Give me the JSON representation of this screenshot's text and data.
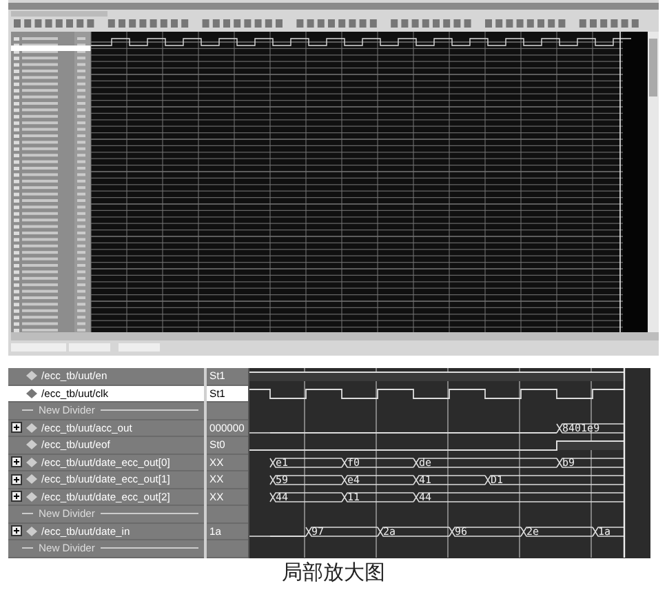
{
  "zoom_panel": {
    "signals": [
      {
        "kind": "bit",
        "name": "/ecc_tb/uut/en",
        "value": "St1",
        "selected": false,
        "expandable": false,
        "high": [
          true,
          true,
          true,
          true,
          true,
          true,
          true,
          true,
          true,
          true
        ]
      },
      {
        "kind": "clock",
        "name": "/ecc_tb/uut/clk",
        "value": "St1",
        "selected": true,
        "expandable": false
      },
      {
        "kind": "divider",
        "name": "New Divider"
      },
      {
        "kind": "bus",
        "name": "/ecc_tb/uut/acc_out",
        "value": "000000",
        "selected": false,
        "expandable": true,
        "slots": [
          {
            "changed": false
          },
          {
            "changed": false
          },
          {
            "changed": false
          },
          {
            "changed": false
          },
          {
            "changed": false
          },
          {
            "changed": false
          },
          {
            "changed": false
          },
          {
            "changed": false
          },
          {
            "changed": true,
            "label": "8401e9"
          },
          {
            "changed": false
          }
        ]
      },
      {
        "kind": "bit",
        "name": "/ecc_tb/uut/eof",
        "value": "St0",
        "selected": false,
        "expandable": false,
        "high": [
          false,
          false,
          false,
          false,
          false,
          false,
          false,
          false,
          true,
          true
        ]
      },
      {
        "kind": "bus",
        "name": "/ecc_tb/uut/date_ecc_out[0]",
        "value": "XX",
        "selected": false,
        "expandable": true,
        "slots": [
          {
            "changed": true,
            "label": "e1"
          },
          {
            "changed": false
          },
          {
            "changed": true,
            "label": "f0"
          },
          {
            "changed": false
          },
          {
            "changed": true,
            "label": "de"
          },
          {
            "changed": false
          },
          {
            "changed": false
          },
          {
            "changed": false
          },
          {
            "changed": true,
            "label": "b9"
          },
          {
            "changed": false
          }
        ]
      },
      {
        "kind": "bus",
        "name": "/ecc_tb/uut/date_ecc_out[1]",
        "value": "XX",
        "selected": false,
        "expandable": true,
        "slots": [
          {
            "changed": true,
            "label": "59"
          },
          {
            "changed": false
          },
          {
            "changed": true,
            "label": "e4"
          },
          {
            "changed": false
          },
          {
            "changed": true,
            "label": "41"
          },
          {
            "changed": false
          },
          {
            "changed": true,
            "label": "D1"
          },
          {
            "changed": false
          },
          {
            "changed": false
          },
          {
            "changed": false
          }
        ]
      },
      {
        "kind": "bus",
        "name": "/ecc_tb/uut/date_ecc_out[2]",
        "value": "XX",
        "selected": false,
        "expandable": true,
        "slots": [
          {
            "changed": true,
            "label": "44"
          },
          {
            "changed": false
          },
          {
            "changed": true,
            "label": "11"
          },
          {
            "changed": false
          },
          {
            "changed": true,
            "label": "44"
          },
          {
            "changed": false
          },
          {
            "changed": false
          },
          {
            "changed": false
          },
          {
            "changed": false
          },
          {
            "changed": false
          }
        ]
      },
      {
        "kind": "divider",
        "name": "New Divider"
      },
      {
        "kind": "bus",
        "name": "/ecc_tb/uut/date_in",
        "value": "1a",
        "selected": false,
        "expandable": true,
        "slots": [
          {
            "changed": false
          },
          {
            "changed": true,
            "label": "97"
          },
          {
            "changed": false
          },
          {
            "changed": true,
            "label": "2a"
          },
          {
            "changed": false
          },
          {
            "changed": true,
            "label": "96"
          },
          {
            "changed": false
          },
          {
            "changed": true,
            "label": "2e"
          },
          {
            "changed": false
          },
          {
            "changed": true,
            "label": "1a"
          }
        ]
      },
      {
        "kind": "divider",
        "name": "New Divider"
      }
    ]
  },
  "caption": "局部放大图"
}
